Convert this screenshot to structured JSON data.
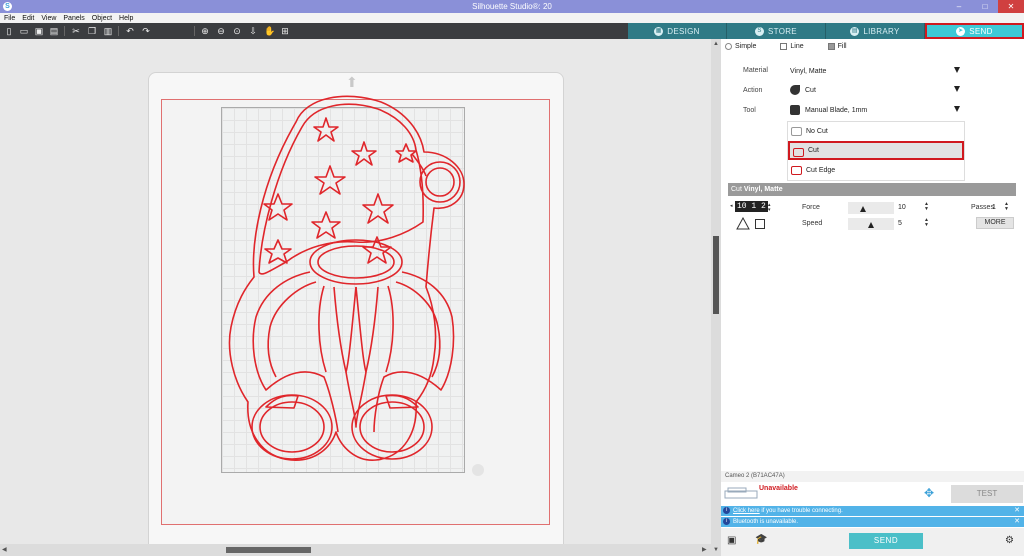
{
  "window": {
    "title": "Silhouette Studio®: 20",
    "app_icon": "S"
  },
  "window_controls": {
    "minimize": "–",
    "maximize": "□",
    "close": "✕"
  },
  "menu": [
    "File",
    "Edit",
    "View",
    "Panels",
    "Object",
    "Help"
  ],
  "toolbar_icons": [
    "new-icon",
    "open-icon",
    "save-icon",
    "print-icon",
    "cut-icon",
    "copy-icon",
    "paste-icon",
    "undo-icon",
    "redo-icon",
    "zoom-in-icon",
    "zoom-out-icon",
    "zoom-select-icon",
    "move-down-icon",
    "pan-hand-icon",
    "fit-page-icon"
  ],
  "nav_tabs": [
    {
      "label": "DESIGN",
      "icon": "grid-icon",
      "active": false
    },
    {
      "label": "STORE",
      "icon": "store-icon",
      "active": false
    },
    {
      "label": "LIBRARY",
      "icon": "library-icon",
      "active": false
    },
    {
      "label": "SEND",
      "icon": "send-icon",
      "active": true
    }
  ],
  "send_panel": {
    "modes": [
      {
        "label": "Simple"
      },
      {
        "label": "Line"
      },
      {
        "label": "Fill"
      }
    ],
    "material": {
      "label": "Material",
      "value": "Vinyl, Matte"
    },
    "action": {
      "label": "Action",
      "value": "Cut"
    },
    "tool": {
      "label": "Tool",
      "value": "Manual Blade, 1mm"
    },
    "tool_options": [
      {
        "label": "No Cut",
        "selected": false
      },
      {
        "label": "Cut",
        "selected": true
      },
      {
        "label": "Cut Edge",
        "selected": false
      }
    ],
    "settings_header": {
      "prefix": "Cut",
      "material": "Vinyl, Matte"
    },
    "blade_value": "10 1 2",
    "force": {
      "label": "Force",
      "value": "10",
      "level": 0.33
    },
    "speed": {
      "label": "Speed",
      "value": "5",
      "level": 0.5
    },
    "passes": {
      "label": "Passes",
      "value": "1"
    },
    "more_label": "MORE"
  },
  "device": {
    "name": "Cameo 2 (B71AC47A)",
    "status": "Unavailable",
    "test_label": "TEST"
  },
  "notices": [
    {
      "link": "Click here",
      "text": " if you have trouble connecting."
    },
    {
      "link": "",
      "text": "Bluetooth is unavailable."
    }
  ],
  "footer": {
    "send_label": "SEND"
  },
  "colors": {
    "accent": "#3ec9d6",
    "cut_line": "#e0262b",
    "highlight": "#d0191f",
    "notice": "#52b3e8"
  }
}
